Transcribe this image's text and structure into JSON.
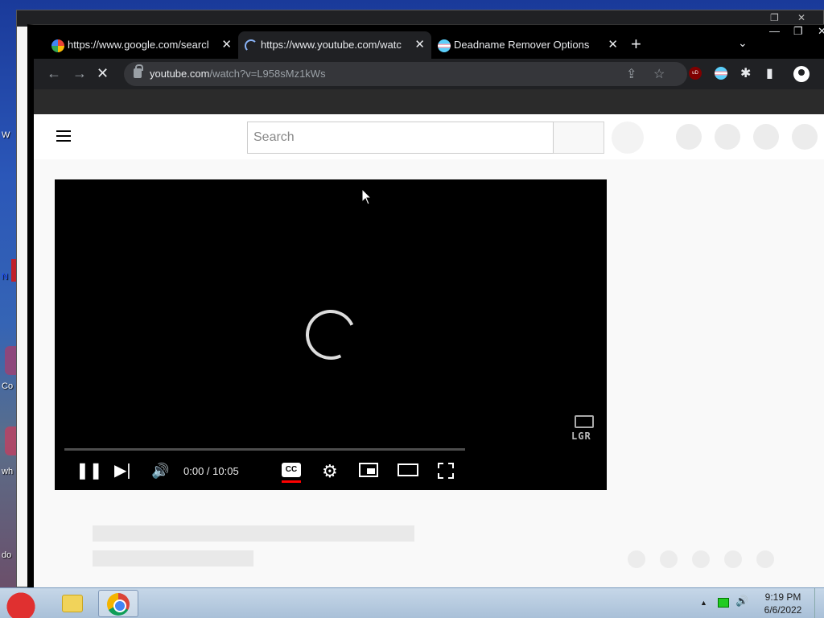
{
  "desktop": {
    "fragments": [
      "W",
      "N",
      "Co",
      "wh",
      "do"
    ]
  },
  "browser": {
    "tabs": [
      {
        "title": "https://www.google.com/search?",
        "favicon": "google-icon",
        "active": false
      },
      {
        "title": "https://www.youtube.com/watch?",
        "favicon": "loading-icon",
        "active": true
      },
      {
        "title": "Deadname Remover Options",
        "favicon": "trans-flag-icon",
        "active": false
      }
    ],
    "new_tab": "+",
    "tab_dropdown": "⌄",
    "window_controls": {
      "minimize": "—",
      "maximize": "❐",
      "close": "✕"
    },
    "nav": {
      "back": "←",
      "forward": "→",
      "stop": "✕"
    },
    "address": {
      "host": "youtube.com",
      "path": "/watch?v=L958sMz1kWs"
    },
    "toolbar_icons": [
      "share-icon",
      "bookmark-star-icon",
      "ublock-icon",
      "trans-extension-icon",
      "extensions-puzzle-icon",
      "side-panel-icon",
      "profile-icon",
      "menu-icon"
    ],
    "extension_ub_text": "uD"
  },
  "youtube": {
    "search_placeholder": "Search",
    "player": {
      "state": "loading",
      "time_current": "0:00",
      "time_total": "10:05",
      "time_display": "0:00 / 10:05",
      "progress": 0,
      "cc_label": "CC",
      "watermark": "LGR"
    }
  },
  "taskbar": {
    "apps": [
      "angry-birds-icon",
      "folder-icon",
      "chrome-icon"
    ],
    "clock_time": "9:19 PM",
    "clock_date": "6/6/2022",
    "tray_up": "▲",
    "volume": "🔊"
  },
  "colors": {
    "accent_red": "#ff0000",
    "chrome_dark": "#202124",
    "taskbar": "#b9cde2"
  }
}
